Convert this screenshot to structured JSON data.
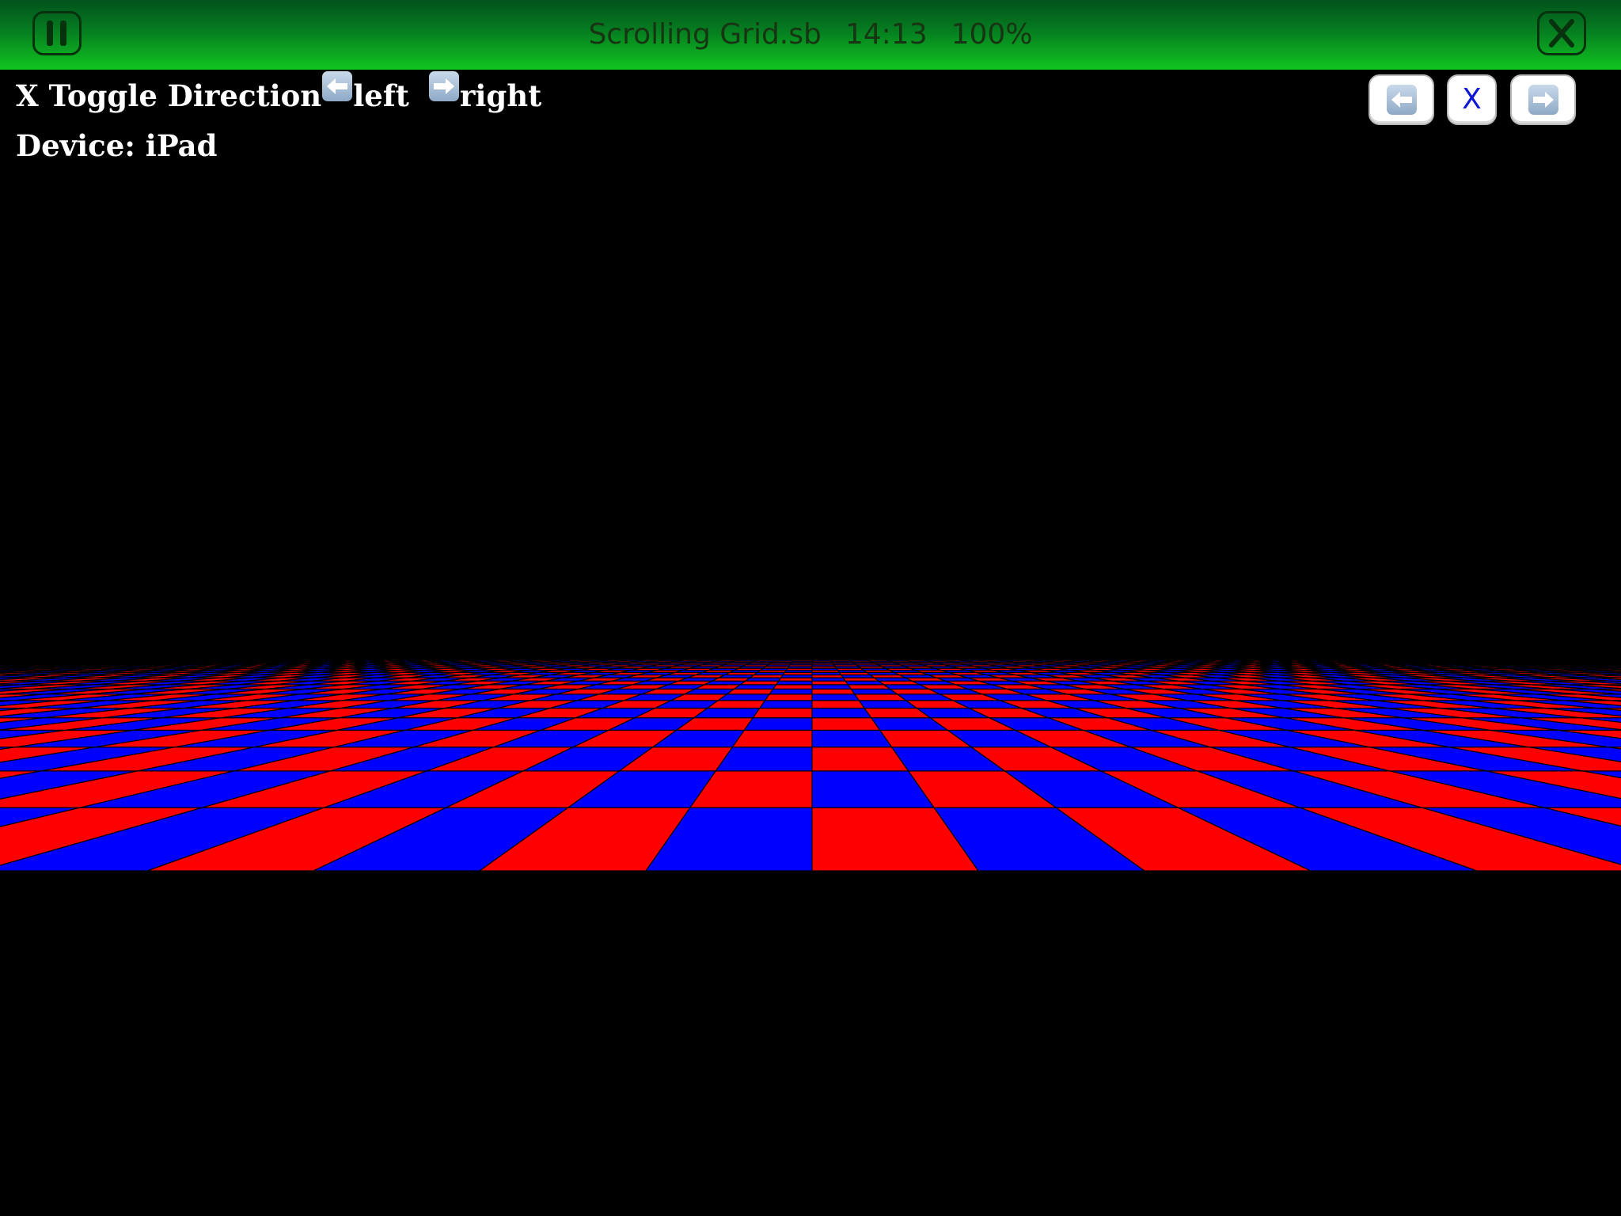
{
  "topbar": {
    "filename": "Scrolling Grid.sb",
    "time": "14:13",
    "zoom": "100%",
    "pause_icon": "pause-icon",
    "close_icon": "close-icon",
    "gradient_top": "#02521c",
    "gradient_bottom": "#11c520"
  },
  "hud": {
    "toggle_text": "X Toggle Direction",
    "left_text": "left",
    "right_text": "right",
    "device_text": "Device: iPad",
    "left_icon": "left-arrow-emoji-icon",
    "right_icon": "right-arrow-emoji-icon"
  },
  "controls": {
    "left_icon": "left-arrow-icon",
    "x_label": "X",
    "right_icon": "right-arrow-icon"
  },
  "scene": {
    "background": "#000000",
    "tile_colors": [
      "#ff0000",
      "#0000ff"
    ],
    "grid_line_color": "#000000",
    "pattern": "checkerboard floor in perspective"
  }
}
